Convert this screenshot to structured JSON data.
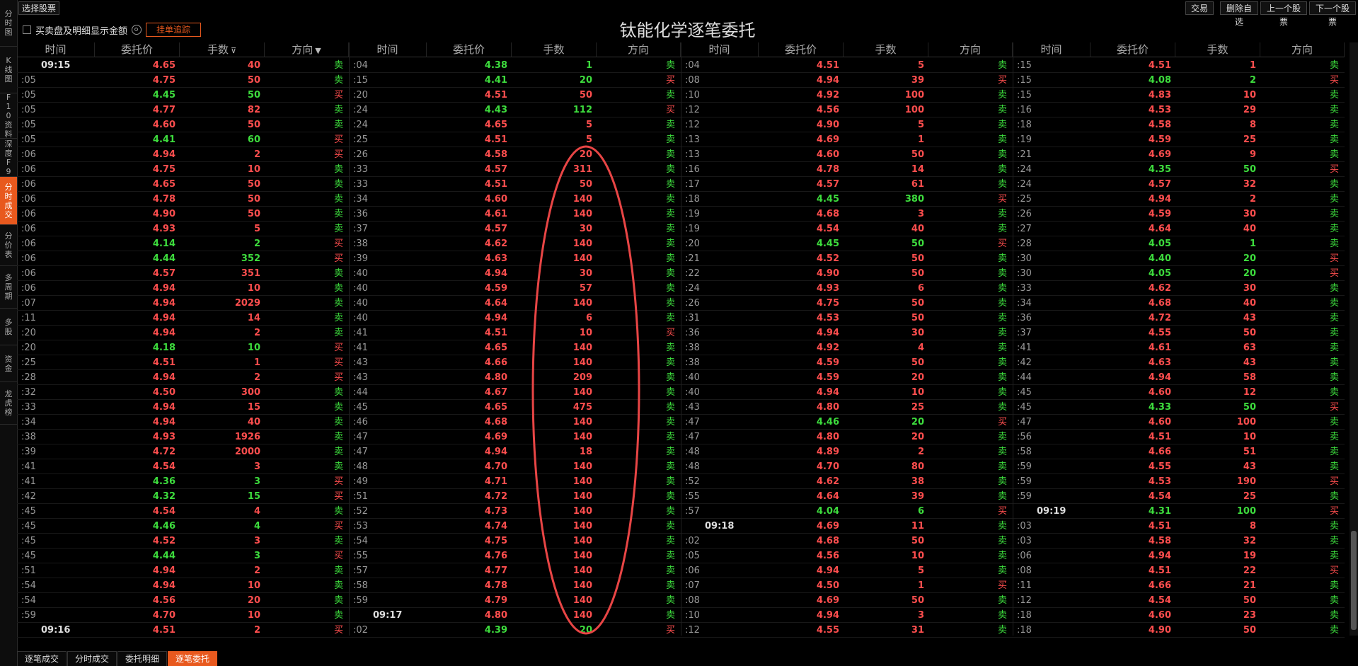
{
  "left_nav": [
    "分时图",
    "K线图",
    "F10资料",
    "深度F9",
    "分时成交",
    "分价表",
    "多周期",
    "多股",
    "资金",
    "龙虎榜"
  ],
  "left_nav_active": 4,
  "top_left_button": "选择股票",
  "top_right_buttons": [
    "交易",
    "删除自选",
    "上一个股票",
    "下一个股票"
  ],
  "title": "钛能化学逐笔委托",
  "options": {
    "checkbox_label": "买卖盘及明细显示金额",
    "track_button": "挂单追踪"
  },
  "headers": [
    "时间",
    "委托价",
    "手数",
    "方向"
  ],
  "sort_marks": {
    "手数": "⊽",
    "方向": "▼"
  },
  "colors": {
    "red": "#ff4e4e",
    "green": "#3ddc3d",
    "accent": "#e8591e",
    "ellipse": "#e84545"
  },
  "columns": [
    [
      [
        "09:15",
        "4.65",
        "40",
        "卖"
      ],
      [
        ":05",
        "4.75",
        "50",
        "卖"
      ],
      [
        ":05",
        "4.45",
        "50",
        "买"
      ],
      [
        ":05",
        "4.77",
        "82",
        "卖"
      ],
      [
        ":05",
        "4.60",
        "50",
        "卖"
      ],
      [
        ":05",
        "4.41",
        "60",
        "买"
      ],
      [
        ":06",
        "4.94",
        "2",
        "买"
      ],
      [
        ":06",
        "4.75",
        "10",
        "卖"
      ],
      [
        ":06",
        "4.65",
        "50",
        "卖"
      ],
      [
        ":06",
        "4.78",
        "50",
        "卖"
      ],
      [
        ":06",
        "4.90",
        "50",
        "卖"
      ],
      [
        ":06",
        "4.93",
        "5",
        "卖"
      ],
      [
        ":06",
        "4.14",
        "2",
        "买"
      ],
      [
        ":06",
        "4.44",
        "352",
        "买"
      ],
      [
        ":06",
        "4.57",
        "351",
        "卖"
      ],
      [
        ":06",
        "4.94",
        "10",
        "卖"
      ],
      [
        ":07",
        "4.94",
        "2029",
        "卖"
      ],
      [
        ":11",
        "4.94",
        "14",
        "卖"
      ],
      [
        ":20",
        "4.94",
        "2",
        "卖"
      ],
      [
        ":20",
        "4.18",
        "10",
        "买"
      ],
      [
        ":25",
        "4.51",
        "1",
        "买"
      ],
      [
        ":28",
        "4.94",
        "2",
        "买"
      ],
      [
        ":32",
        "4.50",
        "300",
        "卖"
      ],
      [
        ":33",
        "4.94",
        "15",
        "卖"
      ],
      [
        ":34",
        "4.94",
        "40",
        "卖"
      ],
      [
        ":38",
        "4.93",
        "1926",
        "卖"
      ],
      [
        ":39",
        "4.72",
        "2000",
        "卖"
      ],
      [
        ":41",
        "4.54",
        "3",
        "卖"
      ],
      [
        ":41",
        "4.36",
        "3",
        "买"
      ],
      [
        ":42",
        "4.32",
        "15",
        "买"
      ],
      [
        ":45",
        "4.54",
        "4",
        "卖"
      ],
      [
        ":45",
        "4.46",
        "4",
        "买"
      ],
      [
        ":45",
        "4.52",
        "3",
        "卖"
      ],
      [
        ":45",
        "4.44",
        "3",
        "买"
      ],
      [
        ":51",
        "4.94",
        "2",
        "卖"
      ],
      [
        ":54",
        "4.94",
        "10",
        "卖"
      ],
      [
        ":54",
        "4.56",
        "20",
        "卖"
      ],
      [
        ":59",
        "4.70",
        "10",
        "卖"
      ],
      [
        "09:16",
        "4.51",
        "2",
        "买"
      ]
    ],
    [
      [
        ":04",
        "4.38",
        "1",
        "卖"
      ],
      [
        ":15",
        "4.41",
        "20",
        "买"
      ],
      [
        ":20",
        "4.51",
        "50",
        "卖"
      ],
      [
        ":24",
        "4.43",
        "112",
        "买"
      ],
      [
        ":24",
        "4.65",
        "5",
        "卖"
      ],
      [
        ":25",
        "4.51",
        "5",
        "卖"
      ],
      [
        ":26",
        "4.58",
        "20",
        "卖"
      ],
      [
        ":33",
        "4.57",
        "311",
        "卖"
      ],
      [
        ":33",
        "4.51",
        "50",
        "卖"
      ],
      [
        ":34",
        "4.60",
        "140",
        "卖"
      ],
      [
        ":36",
        "4.61",
        "140",
        "卖"
      ],
      [
        ":37",
        "4.57",
        "30",
        "卖"
      ],
      [
        ":38",
        "4.62",
        "140",
        "卖"
      ],
      [
        ":39",
        "4.63",
        "140",
        "卖"
      ],
      [
        ":40",
        "4.94",
        "30",
        "卖"
      ],
      [
        ":40",
        "4.59",
        "57",
        "卖"
      ],
      [
        ":40",
        "4.64",
        "140",
        "卖"
      ],
      [
        ":40",
        "4.94",
        "6",
        "卖"
      ],
      [
        ":41",
        "4.51",
        "10",
        "买"
      ],
      [
        ":41",
        "4.65",
        "140",
        "卖"
      ],
      [
        ":43",
        "4.66",
        "140",
        "卖"
      ],
      [
        ":43",
        "4.80",
        "209",
        "卖"
      ],
      [
        ":44",
        "4.67",
        "140",
        "卖"
      ],
      [
        ":45",
        "4.65",
        "475",
        "卖"
      ],
      [
        ":46",
        "4.68",
        "140",
        "卖"
      ],
      [
        ":47",
        "4.69",
        "140",
        "卖"
      ],
      [
        ":47",
        "4.94",
        "18",
        "卖"
      ],
      [
        ":48",
        "4.70",
        "140",
        "卖"
      ],
      [
        ":49",
        "4.71",
        "140",
        "卖"
      ],
      [
        ":51",
        "4.72",
        "140",
        "卖"
      ],
      [
        ":52",
        "4.73",
        "140",
        "卖"
      ],
      [
        ":53",
        "4.74",
        "140",
        "卖"
      ],
      [
        ":54",
        "4.75",
        "140",
        "卖"
      ],
      [
        ":55",
        "4.76",
        "140",
        "卖"
      ],
      [
        ":57",
        "4.77",
        "140",
        "卖"
      ],
      [
        ":58",
        "4.78",
        "140",
        "卖"
      ],
      [
        ":59",
        "4.79",
        "140",
        "卖"
      ],
      [
        "09:17",
        "4.80",
        "140",
        "卖"
      ],
      [
        ":02",
        "4.39",
        "20",
        "买"
      ]
    ],
    [
      [
        ":04",
        "4.51",
        "5",
        "卖"
      ],
      [
        ":08",
        "4.94",
        "39",
        "买"
      ],
      [
        ":10",
        "4.92",
        "100",
        "卖"
      ],
      [
        ":12",
        "4.56",
        "100",
        "卖"
      ],
      [
        ":12",
        "4.90",
        "5",
        "卖"
      ],
      [
        ":13",
        "4.69",
        "1",
        "卖"
      ],
      [
        ":13",
        "4.60",
        "50",
        "卖"
      ],
      [
        ":16",
        "4.78",
        "14",
        "卖"
      ],
      [
        ":17",
        "4.57",
        "61",
        "卖"
      ],
      [
        ":18",
        "4.45",
        "380",
        "买"
      ],
      [
        ":19",
        "4.68",
        "3",
        "卖"
      ],
      [
        ":19",
        "4.54",
        "40",
        "卖"
      ],
      [
        ":20",
        "4.45",
        "50",
        "买"
      ],
      [
        ":21",
        "4.52",
        "50",
        "卖"
      ],
      [
        ":22",
        "4.90",
        "50",
        "卖"
      ],
      [
        ":24",
        "4.93",
        "6",
        "卖"
      ],
      [
        ":26",
        "4.75",
        "50",
        "卖"
      ],
      [
        ":31",
        "4.53",
        "50",
        "卖"
      ],
      [
        ":36",
        "4.94",
        "30",
        "卖"
      ],
      [
        ":38",
        "4.92",
        "4",
        "卖"
      ],
      [
        ":38",
        "4.59",
        "50",
        "卖"
      ],
      [
        ":40",
        "4.59",
        "20",
        "卖"
      ],
      [
        ":40",
        "4.94",
        "10",
        "卖"
      ],
      [
        ":43",
        "4.80",
        "25",
        "卖"
      ],
      [
        ":47",
        "4.46",
        "20",
        "买"
      ],
      [
        ":47",
        "4.80",
        "20",
        "卖"
      ],
      [
        ":48",
        "4.89",
        "2",
        "卖"
      ],
      [
        ":48",
        "4.70",
        "80",
        "卖"
      ],
      [
        ":52",
        "4.62",
        "38",
        "卖"
      ],
      [
        ":55",
        "4.64",
        "39",
        "卖"
      ],
      [
        ":57",
        "4.04",
        "6",
        "买"
      ],
      [
        "09:18",
        "4.69",
        "11",
        "卖"
      ],
      [
        ":02",
        "4.68",
        "50",
        "卖"
      ],
      [
        ":05",
        "4.56",
        "10",
        "卖"
      ],
      [
        ":06",
        "4.94",
        "5",
        "卖"
      ],
      [
        ":07",
        "4.50",
        "1",
        "买"
      ],
      [
        ":08",
        "4.69",
        "50",
        "卖"
      ],
      [
        ":10",
        "4.94",
        "3",
        "卖"
      ],
      [
        ":12",
        "4.55",
        "31",
        "卖"
      ]
    ],
    [
      [
        ":15",
        "4.51",
        "1",
        "卖"
      ],
      [
        ":15",
        "4.08",
        "2",
        "买"
      ],
      [
        ":15",
        "4.83",
        "10",
        "卖"
      ],
      [
        ":16",
        "4.53",
        "29",
        "卖"
      ],
      [
        ":18",
        "4.58",
        "8",
        "卖"
      ],
      [
        ":19",
        "4.59",
        "25",
        "卖"
      ],
      [
        ":21",
        "4.69",
        "9",
        "卖"
      ],
      [
        ":24",
        "4.35",
        "50",
        "买"
      ],
      [
        ":24",
        "4.57",
        "32",
        "卖"
      ],
      [
        ":25",
        "4.94",
        "2",
        "卖"
      ],
      [
        ":26",
        "4.59",
        "30",
        "卖"
      ],
      [
        ":27",
        "4.64",
        "40",
        "卖"
      ],
      [
        ":28",
        "4.05",
        "1",
        "卖"
      ],
      [
        ":30",
        "4.40",
        "20",
        "买"
      ],
      [
        ":30",
        "4.05",
        "20",
        "买"
      ],
      [
        ":33",
        "4.62",
        "30",
        "卖"
      ],
      [
        ":34",
        "4.68",
        "40",
        "卖"
      ],
      [
        ":36",
        "4.72",
        "43",
        "卖"
      ],
      [
        ":37",
        "4.55",
        "50",
        "卖"
      ],
      [
        ":41",
        "4.61",
        "63",
        "卖"
      ],
      [
        ":42",
        "4.63",
        "43",
        "卖"
      ],
      [
        ":44",
        "4.94",
        "58",
        "卖"
      ],
      [
        ":45",
        "4.60",
        "12",
        "卖"
      ],
      [
        ":45",
        "4.33",
        "50",
        "买"
      ],
      [
        ":47",
        "4.60",
        "100",
        "卖"
      ],
      [
        ":56",
        "4.51",
        "10",
        "卖"
      ],
      [
        ":58",
        "4.66",
        "51",
        "卖"
      ],
      [
        ":59",
        "4.55",
        "43",
        "卖"
      ],
      [
        ":59",
        "4.53",
        "190",
        "买"
      ],
      [
        ":59",
        "4.54",
        "25",
        "卖"
      ],
      [
        "09:19",
        "4.31",
        "100",
        "买"
      ],
      [
        ":03",
        "4.51",
        "8",
        "卖"
      ],
      [
        ":03",
        "4.58",
        "32",
        "卖"
      ],
      [
        ":06",
        "4.94",
        "19",
        "卖"
      ],
      [
        ":08",
        "4.51",
        "22",
        "买"
      ],
      [
        ":11",
        "4.66",
        "21",
        "卖"
      ],
      [
        ":12",
        "4.54",
        "50",
        "卖"
      ],
      [
        ":18",
        "4.60",
        "23",
        "卖"
      ],
      [
        ":18",
        "4.90",
        "50",
        "卖"
      ]
    ]
  ],
  "bottom_tabs": [
    "逐笔成交",
    "分时成交",
    "委托明细",
    "逐笔委托"
  ],
  "bottom_active": 3
}
